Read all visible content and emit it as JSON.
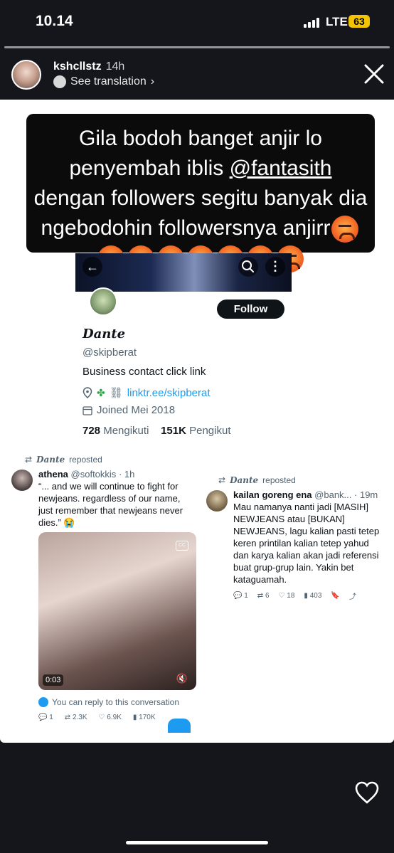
{
  "status_bar": {
    "time": "10.14",
    "network": "LTE",
    "battery": "63"
  },
  "story": {
    "username": "kshcllstz",
    "age": "14h",
    "see_translation": "See translation",
    "caption_parts": [
      "Gila bodoh banget anjir lo penyembah iblis ",
      "@fantasith",
      " dengan followers segitu banyak dia ngebodohin followersnya anjirr"
    ],
    "caption_emoji": "angry-face-emoji"
  },
  "profile": {
    "name": "Dante",
    "handle": "@skipberat",
    "follow_label": "Follow",
    "bio": "Business contact click link",
    "link": "linktr.ee/skipberat",
    "joined": "Joined Mei 2018",
    "following_count": "728",
    "following_label": "Mengikuti",
    "followers_count": "151K",
    "followers_label": "Pengikut"
  },
  "tweets": [
    {
      "repost_by": "Dante",
      "repost_label": "reposted",
      "name": "athena",
      "handle": "@softokkis",
      "time": "· 1h",
      "text": "“... and we will continue to fight for newjeans. regardless of our name, just remember that newjeans never dies.” 😭",
      "video_time": "0:03",
      "reply_notice": "You can reply to this conversation",
      "replies": "1",
      "reposts": "2.3K",
      "likes": "6.9K",
      "views": "170K"
    },
    {
      "repost_by": "Dante",
      "repost_label": "reposted",
      "name": "kailan goreng ena",
      "handle": "@bank...",
      "time": "· 19m",
      "text": "Mau namanya nanti jadi [MASIH] NEWJEANS atau [BUKAN] NEWJEANS, lagu kalian pasti tetep keren printilan kalian tetep yahud dan karya kalian akan jadi referensi buat grup-grup lain. Yakin bet kataguamah.",
      "replies": "1",
      "reposts": "6",
      "likes": "18",
      "views": "403"
    }
  ]
}
